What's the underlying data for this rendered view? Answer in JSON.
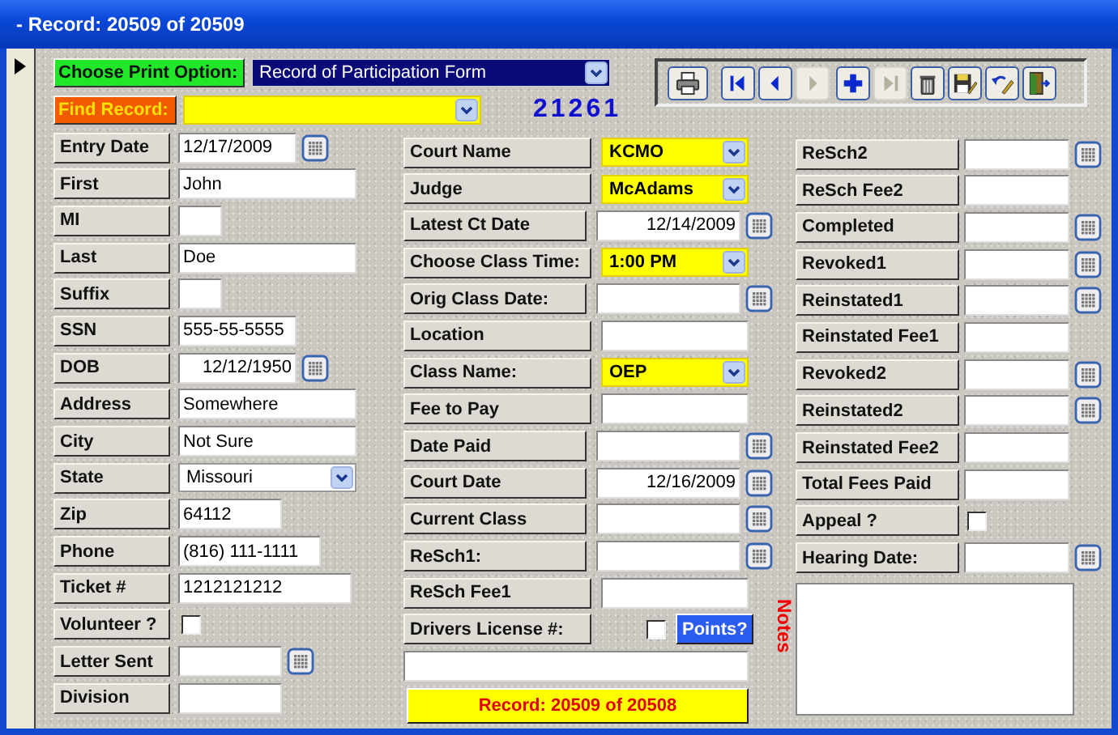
{
  "window": {
    "title": "- Record: 20509 of 20509"
  },
  "print_option": {
    "label": "Choose Print Option:",
    "value": "Record of Participation Form"
  },
  "find_record": {
    "label": "Find Record:"
  },
  "record_number": "21261",
  "toolbar": [
    {
      "kind": "print",
      "disabled": false
    },
    {
      "kind": "first",
      "disabled": false
    },
    {
      "kind": "previous",
      "disabled": false
    },
    {
      "kind": "next",
      "disabled": true
    },
    {
      "kind": "new",
      "disabled": false
    },
    {
      "kind": "last",
      "disabled": true
    },
    {
      "kind": "delete",
      "disabled": false
    },
    {
      "kind": "save",
      "disabled": false
    },
    {
      "kind": "undo",
      "disabled": false
    },
    {
      "kind": "exit",
      "disabled": false
    }
  ],
  "columns": [
    {
      "fields": [
        {
          "kind": "date",
          "label": "Entry Date",
          "value": "12/17/2009"
        },
        {
          "kind": "text",
          "label": "First",
          "value": "John"
        },
        {
          "kind": "text",
          "label": "MI"
        },
        {
          "kind": "text",
          "label": "Last",
          "value": "Doe"
        },
        {
          "kind": "text",
          "label": "Suffix"
        },
        {
          "kind": "text",
          "label": "SSN",
          "value": "555-55-5555"
        },
        {
          "kind": "date",
          "label": "DOB",
          "value": "12/12/1950"
        },
        {
          "kind": "text",
          "label": "Address",
          "value": "Somewhere"
        },
        {
          "kind": "text",
          "label": "City",
          "value": "Not Sure"
        },
        {
          "kind": "combo",
          "label": "State",
          "value": "Missouri",
          "highlighted": false
        },
        {
          "kind": "text",
          "label": "Zip",
          "value": "64112"
        },
        {
          "kind": "text",
          "label": "Phone",
          "value": "(816) 111-1111"
        },
        {
          "kind": "text",
          "label": "Ticket #",
          "value": "1212121212"
        },
        {
          "kind": "check",
          "label": "Volunteer ?",
          "checked": false
        },
        {
          "kind": "date",
          "label": "Letter Sent"
        },
        {
          "kind": "text",
          "label": "Division"
        }
      ]
    },
    {
      "fields": [
        {
          "kind": "combo",
          "label": "Court Name",
          "value": "KCMO",
          "highlighted": true
        },
        {
          "kind": "combo",
          "label": "Judge",
          "value": "McAdams",
          "highlighted": true
        },
        {
          "kind": "date",
          "label": "Latest Ct Date",
          "value": "12/14/2009"
        },
        {
          "kind": "combo",
          "label": "Choose Class Time:",
          "value": "1:00 PM",
          "highlighted": true
        },
        {
          "kind": "date",
          "label": "Orig Class Date:"
        },
        {
          "kind": "text",
          "label": "Location"
        },
        {
          "kind": "combo",
          "label": "Class Name:",
          "value": "OEP",
          "highlighted": true
        },
        {
          "kind": "text",
          "label": "Fee to Pay"
        },
        {
          "kind": "date",
          "label": "Date Paid"
        },
        {
          "kind": "date",
          "label": "Court Date",
          "value": "12/16/2009"
        },
        {
          "kind": "date",
          "label": "Current Class"
        },
        {
          "kind": "date",
          "label": "ReSch1:"
        },
        {
          "kind": "text",
          "label": "ReSch Fee1"
        },
        {
          "kind": "license",
          "label": "Drivers License #:",
          "checked": false,
          "button": "Points?"
        },
        {
          "kind": "input"
        },
        {
          "kind": "status",
          "text": "Record: 20509 of 20508"
        }
      ]
    },
    {
      "fields": [
        {
          "kind": "date",
          "label": "ReSch2"
        },
        {
          "kind": "text",
          "label": "ReSch Fee2"
        },
        {
          "kind": "date",
          "label": "Completed"
        },
        {
          "kind": "date",
          "label": "Revoked1"
        },
        {
          "kind": "date",
          "label": "Reinstated1"
        },
        {
          "kind": "text",
          "label": "Reinstated Fee1"
        },
        {
          "kind": "date",
          "label": "Revoked2"
        },
        {
          "kind": "date",
          "label": "Reinstated2"
        },
        {
          "kind": "text",
          "label": "Reinstated Fee2"
        },
        {
          "kind": "text",
          "label": "Total Fees Paid"
        },
        {
          "kind": "check",
          "label": "Appeal ?",
          "checked": false
        },
        {
          "kind": "date",
          "label": "Hearing Date:"
        },
        {
          "kind": "notes",
          "label": "Notes"
        }
      ]
    }
  ]
}
